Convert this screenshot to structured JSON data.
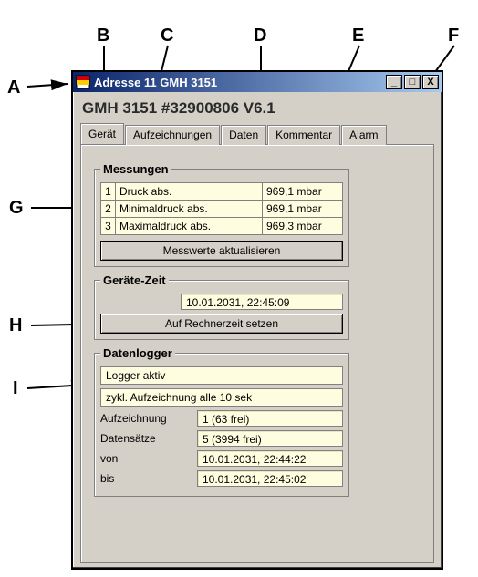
{
  "annotations": {
    "A": "A",
    "B": "B",
    "C": "C",
    "D": "D",
    "E": "E",
    "F": "F",
    "G": "G",
    "H": "H",
    "I": "I"
  },
  "titlebar": {
    "title": "Adresse 11 GMH 3151",
    "min_glyph": "_",
    "max_glyph": "□",
    "close_glyph": "X"
  },
  "device_header": "GMH 3151 #32900806 V6.1",
  "tabs": {
    "geraet": "Gerät",
    "aufzeichnungen": "Aufzeichnungen",
    "daten": "Daten",
    "kommentar": "Kommentar",
    "alarm": "Alarm"
  },
  "messungen": {
    "title": "Messungen",
    "rows": [
      {
        "idx": "1",
        "name": "Druck abs.",
        "value": "969,1 mbar"
      },
      {
        "idx": "2",
        "name": "Minimaldruck abs.",
        "value": "969,1 mbar"
      },
      {
        "idx": "3",
        "name": "Maximaldruck abs.",
        "value": "969,3 mbar"
      }
    ],
    "update_btn": "Messwerte aktualisieren"
  },
  "geraete_zeit": {
    "title": "Geräte-Zeit",
    "value": "10.01.2031, 22:45:09",
    "set_btn": "Auf Rechnerzeit setzen"
  },
  "datenlogger": {
    "title": "Datenlogger",
    "status": "Logger aktiv",
    "mode": "zykl. Aufzeichnung alle 10 sek",
    "aufzeichnung_label": "Aufzeichnung",
    "aufzeichnung_value": "1 (63 frei)",
    "datensaetze_label": "Datensätze",
    "datensaetze_value": "5 (3994 frei)",
    "von_label": "von",
    "von_value": "10.01.2031, 22:44:22",
    "bis_label": "bis",
    "bis_value": "10.01.2031, 22:45:02"
  }
}
